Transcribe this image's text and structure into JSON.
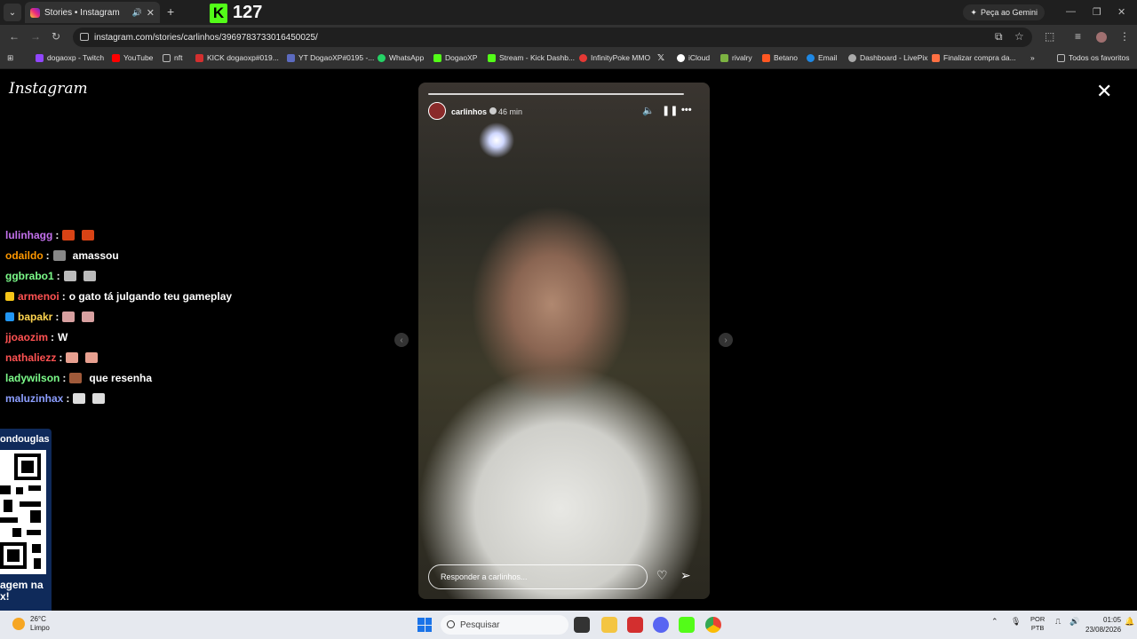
{
  "browser": {
    "tab_title": "Stories • Instagram",
    "kick_count": "127",
    "gemini_label": "Peça ao Gemini",
    "url": "instagram.com/stories/carlinhos/3969783733016450025/",
    "bookmarks": [
      {
        "label": "dogaoxp - Twitch",
        "color": "#9146ff"
      },
      {
        "label": "YouTube",
        "color": "#ff0000"
      },
      {
        "label": "nft",
        "color": "#777777"
      },
      {
        "label": "KICK dogaoxp#019...",
        "color": "#d32f2f"
      },
      {
        "label": "YT DogaoXP#0195 -...",
        "color": "#5c6bc0"
      },
      {
        "label": "WhatsApp",
        "color": "#25d366"
      },
      {
        "label": "DogaoXP",
        "color": "#53fc18"
      },
      {
        "label": "Stream - Kick Dashb...",
        "color": "#53fc18"
      },
      {
        "label": "InfinityPoke MMO",
        "color": "#e53935"
      },
      {
        "label": "",
        "color": "#000000"
      },
      {
        "label": "iCloud",
        "color": "#ffffff"
      },
      {
        "label": "rivalry",
        "color": "#7cb342"
      },
      {
        "label": "Betano",
        "color": "#ff5722"
      },
      {
        "label": "Email",
        "color": "#1e88e5"
      },
      {
        "label": "Dashboard - LivePix",
        "color": "#aaaaaa"
      },
      {
        "label": "Finalizar compra da...",
        "color": "#ff7043"
      }
    ],
    "all_favorites": "Todos os favoritos"
  },
  "instagram": {
    "logo": "Instagram",
    "story": {
      "username": "carlinhos",
      "time": "46 min",
      "reply_placeholder": "Responder a carlinhos..."
    }
  },
  "chat": [
    {
      "user": "lulinhagg",
      "color": "#c471ed",
      "message": "",
      "emotes": [
        "#d84315",
        "#d84315"
      ],
      "badge": ""
    },
    {
      "user": "odaildo",
      "color": "#ff9800",
      "message": "amassou",
      "emotes": [
        "#888888"
      ],
      "badge": ""
    },
    {
      "user": "ggbrabo1",
      "color": "#7cfc8a",
      "message": "",
      "emotes": [
        "#bbbbbb",
        "#bbbbbb"
      ],
      "badge": ""
    },
    {
      "user": "armenoi",
      "color": "#ff5252",
      "message": "o gato tá julgando teu gameplay",
      "emotes": [],
      "badge": "#f5c518"
    },
    {
      "user": "bapakr",
      "color": "#ffd54f",
      "message": "",
      "emotes": [
        "#d8a0a0",
        "#d8a0a0"
      ],
      "badge": "#2196f3"
    },
    {
      "user": "jjoaozim",
      "color": "#ff5252",
      "message": "W",
      "emotes": [],
      "badge": ""
    },
    {
      "user": "nathaliezz",
      "color": "#ff5252",
      "message": "",
      "emotes": [
        "#e8a090",
        "#e8a090"
      ],
      "badge": ""
    },
    {
      "user": "ladywilson",
      "color": "#7cfc8a",
      "message": "que resenha",
      "emotes": [
        "#a05a3a"
      ],
      "badge": ""
    },
    {
      "user": "maluzinhax",
      "color": "#8c9eff",
      "message": "",
      "emotes": [
        "#dddddd",
        "#dddddd"
      ],
      "badge": ""
    }
  ],
  "qr": {
    "title": "ondouglas",
    "footer_line1": "agem na",
    "footer_line2": "x!"
  },
  "taskbar": {
    "temp": "26°C",
    "weather": "Limpo",
    "search_placeholder": "Pesquisar",
    "lang1": "POR",
    "lang2": "PTB",
    "time": "01:05",
    "date": "23/08/2026"
  }
}
